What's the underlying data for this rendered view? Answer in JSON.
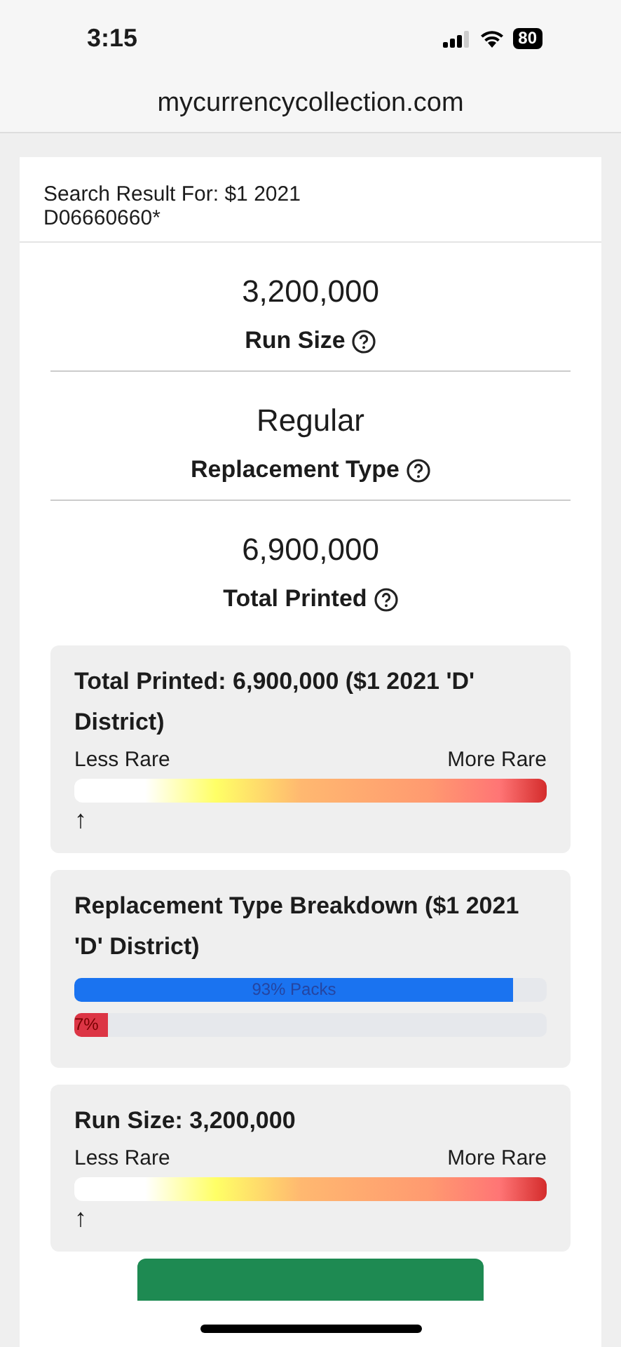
{
  "status_bar": {
    "time": "3:15",
    "battery": "80"
  },
  "browser": {
    "url": "mycurrencycollection.com"
  },
  "search_result": "Search Result For: $1 2021 D06660660*",
  "stats": [
    {
      "value": "3,200,000",
      "label": "Run Size"
    },
    {
      "value": "Regular",
      "label": "Replacement Type"
    },
    {
      "value": "6,900,000",
      "label": "Total Printed"
    }
  ],
  "panels": [
    {
      "kind": "rarity",
      "title": "Total Printed: 6,900,000 ($1 2021 'D' District)",
      "low_label": "Less Rare",
      "high_label": "More Rare",
      "marker": "↑"
    },
    {
      "kind": "breakdown",
      "title": "Replacement Type Breakdown ($1 2021 'D' District)",
      "bars": [
        {
          "label": "93% Packs",
          "level": 0.93,
          "color": "#1a73f0"
        },
        {
          "label": "7%",
          "level": 0.07,
          "color": "#dc3545"
        }
      ]
    },
    {
      "kind": "rarity",
      "title": "Run Size: 3,200,000",
      "low_label": "Less Rare",
      "high_label": "More Rare",
      "marker": "↑"
    }
  ]
}
